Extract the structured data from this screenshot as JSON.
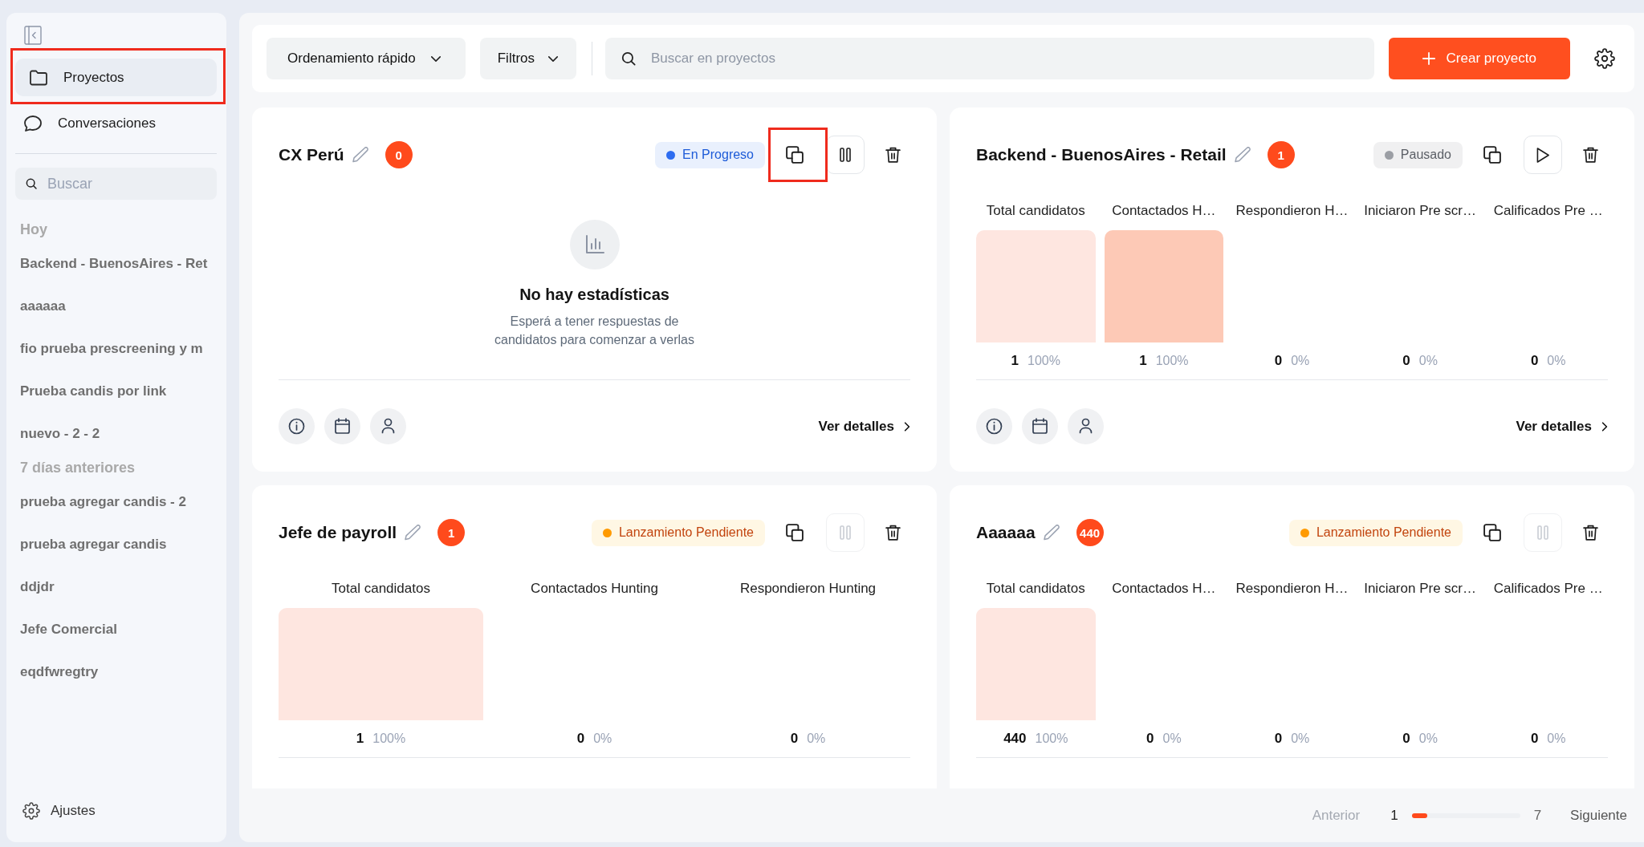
{
  "sidebar": {
    "nav": [
      {
        "label": "Proyectos",
        "selected": true,
        "outlined": true
      },
      {
        "label": "Conversaciones",
        "selected": false,
        "outlined": false
      }
    ],
    "search": {
      "placeholder": "Buscar"
    },
    "groups": [
      {
        "heading": "Hoy",
        "items": [
          "Backend - BuenosAires - Ret",
          "aaaaaa",
          "fio prueba prescreening y m",
          "Prueba candis por link",
          "nuevo - 2 - 2"
        ]
      },
      {
        "heading": "7 días anteriores",
        "items": [
          "prueba agregar candis - 2",
          "prueba agregar candis",
          "ddjdr",
          "Jefe Comercial",
          "eqdfwregtry"
        ]
      }
    ],
    "settings": "Ajustes"
  },
  "toolbar": {
    "sort": "Ordenamiento rápido",
    "filters": "Filtros",
    "search": {
      "placeholder": "Buscar en proyectos"
    },
    "create": "Crear proyecto"
  },
  "cards": [
    {
      "title": "CX Perú",
      "count": "0",
      "status": {
        "kind": "progress",
        "label": "En Progreso",
        "color": "#2d6cf0"
      },
      "copy_outlined": true,
      "toggle": {
        "kind": "pause",
        "disabled": false
      },
      "empty": {
        "title": "No hay estadísticas",
        "text": "Esperá a tener respuestas de candidatos para comenzar a verlas"
      },
      "footer": {
        "link": "Ver detalles"
      }
    },
    {
      "title": "Backend - BuenosAires - Retail",
      "count": "1",
      "status": {
        "kind": "paused",
        "label": "Pausado",
        "color": "#9b9ea4"
      },
      "copy_outlined": false,
      "toggle": {
        "kind": "play",
        "disabled": false
      },
      "metrics": [
        {
          "label": "Total candidatos",
          "value": "1",
          "percent": "100%",
          "color": "#fee6e0"
        },
        {
          "label": "Contactados H…",
          "value": "1",
          "percent": "100%",
          "color": "#fdc9b6"
        },
        {
          "label": "Respondieron H…",
          "value": "0",
          "percent": "0%"
        },
        {
          "label": "Iniciaron Pre scr…",
          "value": "0",
          "percent": "0%"
        },
        {
          "label": "Calificados Pre …",
          "value": "0",
          "percent": "0%"
        }
      ],
      "footer": {
        "link": "Ver detalles"
      }
    },
    {
      "title": "Jefe de payroll",
      "count": "1",
      "status": {
        "kind": "pending",
        "label": "Lanzamiento Pendiente",
        "color": "#ff9a00"
      },
      "copy_outlined": false,
      "toggle": {
        "kind": "pause",
        "disabled": true
      },
      "metrics": [
        {
          "label": "Total candidatos",
          "value": "1",
          "percent": "100%",
          "color": "#fee6e0"
        },
        {
          "label": "Contactados Hunting",
          "value": "0",
          "percent": "0%"
        },
        {
          "label": "Respondieron Hunting",
          "value": "0",
          "percent": "0%"
        }
      ]
    },
    {
      "title": "Aaaaaa",
      "count": "440",
      "status": {
        "kind": "pending",
        "label": "Lanzamiento Pendiente",
        "color": "#ff9a00"
      },
      "copy_outlined": false,
      "toggle": {
        "kind": "pause",
        "disabled": true
      },
      "metrics": [
        {
          "label": "Total candidatos",
          "value": "440",
          "percent": "100%",
          "color": "#fee6e0"
        },
        {
          "label": "Contactados H…",
          "value": "0",
          "percent": "0%"
        },
        {
          "label": "Respondieron H…",
          "value": "0",
          "percent": "0%"
        },
        {
          "label": "Iniciaron Pre scr…",
          "value": "0",
          "percent": "0%"
        },
        {
          "label": "Calificados Pre …",
          "value": "0",
          "percent": "0%"
        }
      ]
    }
  ],
  "pagination": {
    "previous": "Anterior",
    "previous_disabled": true,
    "current": "1",
    "level": 0.14,
    "total": "7",
    "next": "Siguiente"
  }
}
